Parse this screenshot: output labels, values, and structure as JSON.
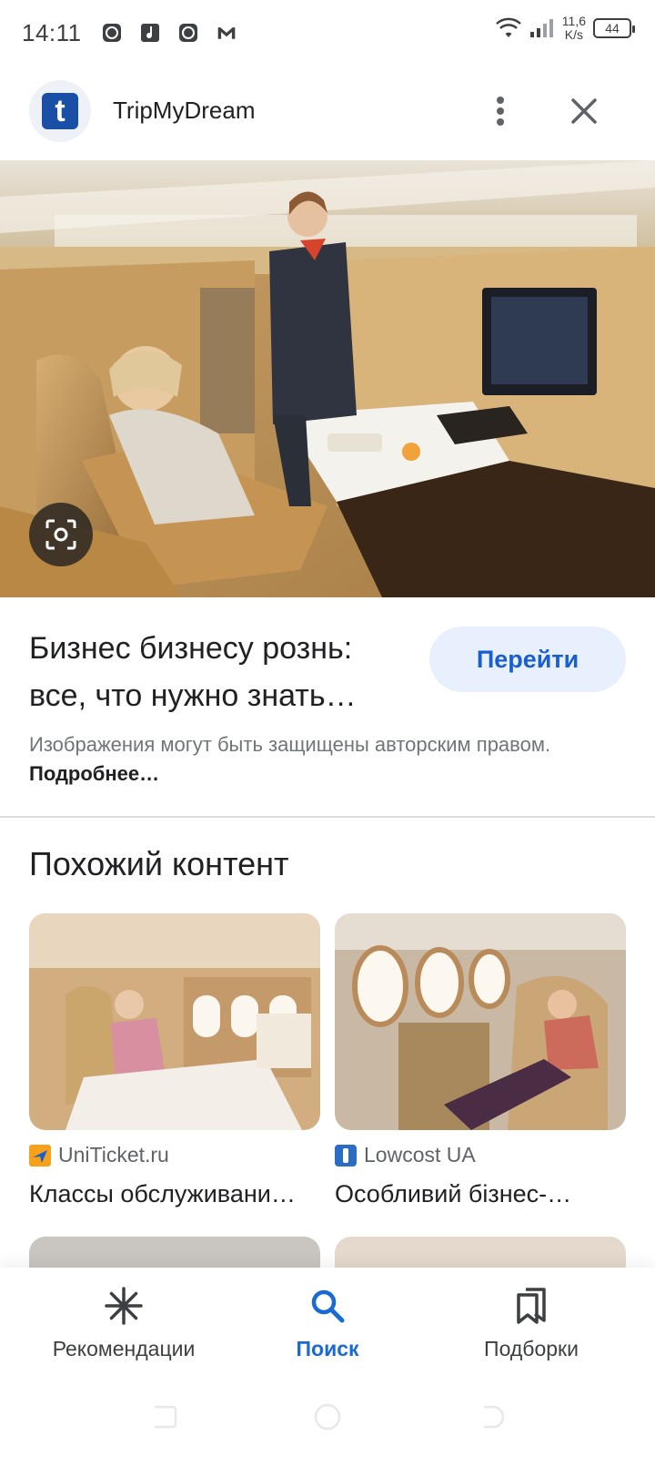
{
  "status": {
    "time": "14:11",
    "net_speed_value": "11,6",
    "net_speed_unit": "K/s",
    "battery": "44"
  },
  "header": {
    "site_name": "TripMyDream",
    "logo_letter": "t"
  },
  "result": {
    "title": "Бизнес бизнесу рознь: все, что нужно знать…",
    "visit_label": "Перейти",
    "copyright_text": "Изображения могут быть защищены авторским правом.",
    "learn_more": "Подробнее…"
  },
  "related": {
    "heading": "Похожий контент",
    "items": [
      {
        "source": "UniTicket.ru",
        "title": "Классы обслуживани…"
      },
      {
        "source": "Lowcost UA",
        "title": "Особливий бізнес-…"
      }
    ]
  },
  "nav": {
    "items": [
      {
        "label": "Рекомендации",
        "icon": "asterisk-icon"
      },
      {
        "label": "Поиск",
        "icon": "search-icon",
        "active": true
      },
      {
        "label": "Подборки",
        "icon": "collections-icon"
      }
    ]
  },
  "colors": {
    "accent": "#1a6ad6",
    "button_bg": "#e8f0fe",
    "logo_blue": "#1a4fa6"
  }
}
